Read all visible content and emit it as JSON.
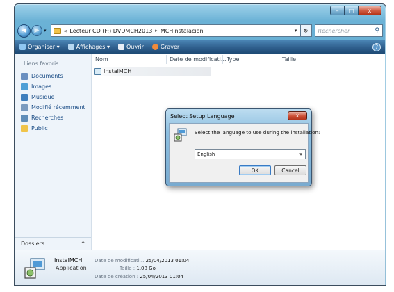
{
  "window": {
    "controls": {
      "minimize": "–",
      "maximize": "□",
      "close": "x"
    }
  },
  "navbar": {
    "back_glyph": "◀",
    "forward_glyph": "▶",
    "dropdown_glyph": "▾",
    "breadcrumb": [
      "«",
      "Lecteur CD (F:) DVDMCH2013",
      "MCHinstalacion"
    ],
    "separator_glyph": "▸",
    "address_dropdown_glyph": "▾",
    "refresh_glyph": "↻",
    "search_placeholder": "Rechercher",
    "search_glyph": "⚲"
  },
  "toolbar": {
    "organize": "Organiser ▾",
    "views": "Affichages ▾",
    "open": "Ouvrir",
    "burn": "Graver",
    "help": "?",
    "organize_color": "#8fc6f1",
    "views_color": "#b7d7f0",
    "open_color": "#e8eef6",
    "burn_color": "#f08a3a"
  },
  "navpane": {
    "title": "Liens favoris",
    "items": [
      {
        "label": "Documents",
        "color": "#6a8fc0"
      },
      {
        "label": "Images",
        "color": "#4e9fd6"
      },
      {
        "label": "Musique",
        "color": "#3f7fbd"
      },
      {
        "label": "Modifié récemment",
        "color": "#7a9bbf"
      },
      {
        "label": "Recherches",
        "color": "#5f8db8"
      },
      {
        "label": "Public",
        "color": "#f0c44a"
      }
    ],
    "folders_label": "Dossiers",
    "folders_chevron": "^"
  },
  "filelist": {
    "columns": [
      "Nom",
      "Date de modificati...",
      "Type",
      "Taille"
    ],
    "files": [
      {
        "name": "InstalMCH"
      }
    ]
  },
  "dialog": {
    "title": "Select Setup Language",
    "close_glyph": "x",
    "message": "Select the language to use during the installation:",
    "selected_language": "English",
    "select_arrow": "▾",
    "ok": "OK",
    "cancel": "Cancel"
  },
  "details": {
    "name": "InstalMCH",
    "type": "Application",
    "modified_label": "Date de modificati...",
    "modified_value": "25/04/2013 01:04",
    "size_label": "Taille :",
    "size_value": "1,08 Go",
    "created_label": "Date de création :",
    "created_value": "25/04/2013 01:04"
  }
}
